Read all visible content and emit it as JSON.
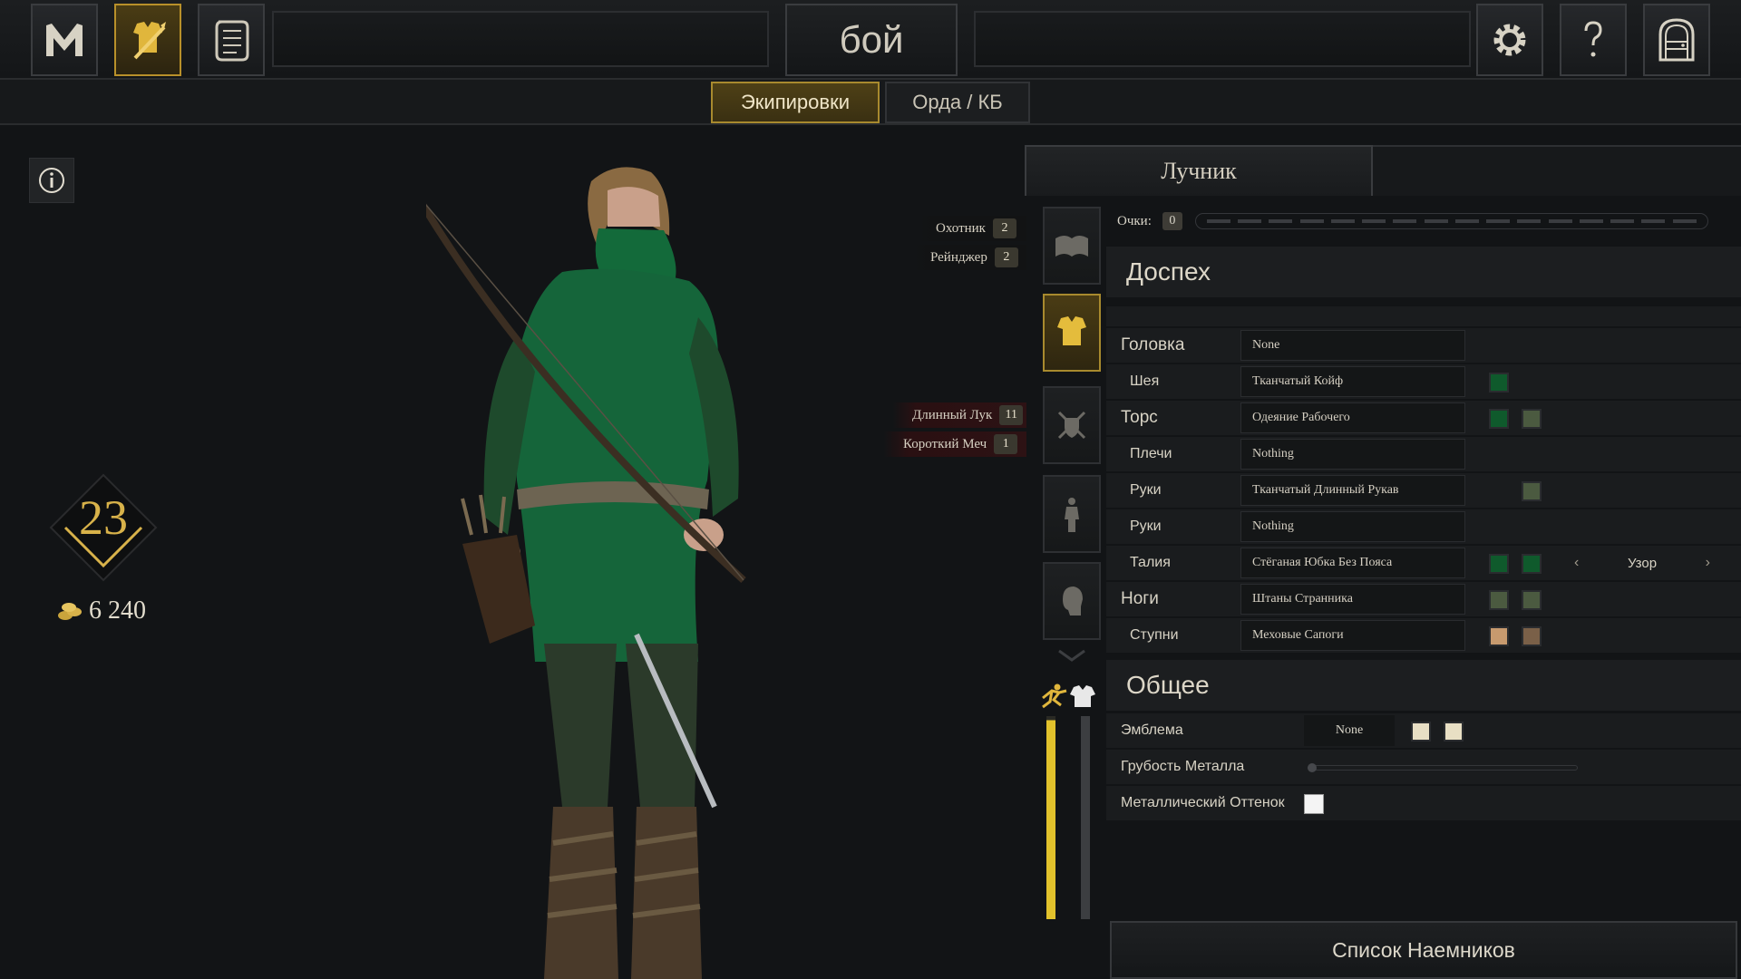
{
  "topbar": {
    "title": "бой",
    "buttons": [
      {
        "icon": "mordhau-logo-icon"
      },
      {
        "icon": "armor-customize-icon",
        "active": true
      },
      {
        "icon": "scroll-icon"
      },
      {
        "icon": "gear-icon"
      },
      {
        "icon": "question-mark-icon"
      },
      {
        "icon": "exit-door-icon"
      }
    ]
  },
  "subtabs": [
    {
      "label": "Экипировки",
      "active": true
    },
    {
      "label": "Орда / КБ",
      "active": false
    }
  ],
  "player": {
    "level": "23",
    "gold": "6 240"
  },
  "perks": [
    {
      "label": "Охотник",
      "value": "2"
    },
    {
      "label": "Рейнджер",
      "value": "2"
    }
  ],
  "weapons": [
    {
      "label": "Длинный Лук",
      "value": "11"
    },
    {
      "label": "Короткий Меч",
      "value": "1"
    }
  ],
  "panel": {
    "class_name": "Лучник",
    "points_label": "Очки:",
    "points_value": "0",
    "points_slots": 16
  },
  "armor": {
    "heading": "Доспех",
    "rows": [
      {
        "label": "Головка",
        "value": "None",
        "big": true,
        "swatches": []
      },
      {
        "label": "Шея",
        "value": "Тканчатый Койф",
        "big": false,
        "swatches": [
          "#0f5a2c"
        ]
      },
      {
        "label": "Торс",
        "value": "Одеяние Рабочего",
        "big": true,
        "swatches": [
          "#0f5a2c",
          "#4b5a40"
        ]
      },
      {
        "label": "Плечи",
        "value": "Nothing",
        "big": false,
        "swatches": []
      },
      {
        "label": "Руки",
        "value": "Тканчатый Длинный Рукав",
        "big": false,
        "swatches": [
          null,
          "#4b5a40"
        ]
      },
      {
        "label": "Руки",
        "value": "Nothing",
        "big": false,
        "swatches": []
      },
      {
        "label": "Талия",
        "value": "Стёганая Юбка Без Пояса",
        "big": false,
        "swatches": [
          "#0f5a2c",
          "#0f5a2c"
        ],
        "pattern": "Узор"
      },
      {
        "label": "Ноги",
        "value": "Штаны Странника",
        "big": true,
        "swatches": [
          "#4b5a40",
          "#4b5a40"
        ]
      },
      {
        "label": "Ступни",
        "value": "Меховые Сапоги",
        "big": false,
        "swatches": [
          "#c79a6e",
          "#7a6048"
        ]
      }
    ]
  },
  "general": {
    "heading": "Общее",
    "emblem_label": "Эмблема",
    "emblem_value": "None",
    "emblem_colors": [
      "#e8dfc4",
      "#e8dfc4"
    ],
    "roughness_label": "Грубость Металла",
    "roughness_value": 0.0,
    "tint_label": "Металлический Оттенок",
    "tint_color": "#f4f4f4"
  },
  "stats": {
    "speed_fill": 0.98,
    "armor_fill": 0.0
  },
  "mercenaries_button": "Список Наемников",
  "colors": {
    "accent_gold": "#b8902a",
    "panel_bg": "#1a1c1e"
  }
}
